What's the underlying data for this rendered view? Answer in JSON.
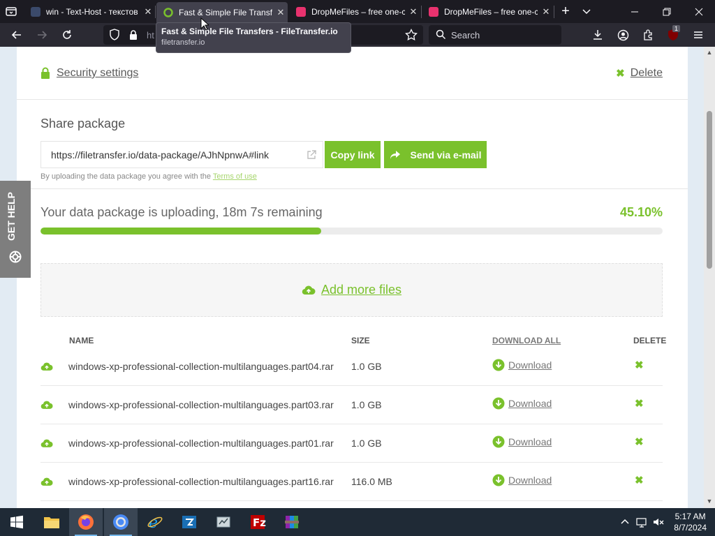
{
  "browser": {
    "tabs": [
      {
        "title": "win - Text-Host - текстов",
        "close": "✕",
        "active": false,
        "favicon_color": "#3b4a6b"
      },
      {
        "title": "Fast & Simple File Transfe",
        "close": "✕",
        "active": true,
        "favicon_color": "#7ac12c"
      },
      {
        "title": "DropMeFiles – free one-cli",
        "close": "✕",
        "active": false,
        "favicon_color": "#e8326e"
      },
      {
        "title": "DropMeFiles – free one-cli",
        "close": "✕",
        "active": false,
        "favicon_color": "#e8326e"
      }
    ],
    "new_tab": "+",
    "url_visible_fragment": "ht                                          wA",
    "search_placeholder": "Search",
    "notification_badge": "1",
    "tooltip": {
      "title": "Fast & Simple File Transfers - FileTransfer.io",
      "host": "filetransfer.io"
    }
  },
  "page": {
    "security_link": "Security settings",
    "delete_link": "Delete",
    "share": {
      "title": "Share package",
      "link_value": "https://filetransfer.io/data-package/AJhNpnwA#link",
      "copy_button": "Copy link",
      "email_button": "Send via e-mail",
      "terms_prefix": "By uploading the data package you agree with the",
      "terms_link": "Terms of use"
    },
    "upload": {
      "status": "Your data package is uploading, 18m 7s remaining",
      "percent_text": "45.10%",
      "progress_fraction": 0.451
    },
    "add_more": "Add more files",
    "table": {
      "headers": {
        "name": "NAME",
        "size": "SIZE",
        "download_all": "DOWNLOAD ALL",
        "delete": "DELETE"
      },
      "rows": [
        {
          "name": "windows-xp-professional-collection-multilanguages.part04.rar",
          "size": "1.0 GB",
          "download": "Download"
        },
        {
          "name": "windows-xp-professional-collection-multilanguages.part03.rar",
          "size": "1.0 GB",
          "download": "Download"
        },
        {
          "name": "windows-xp-professional-collection-multilanguages.part01.rar",
          "size": "1.0 GB",
          "download": "Download"
        },
        {
          "name": "windows-xp-professional-collection-multilanguages.part16.rar",
          "size": "116.0 MB",
          "download": "Download"
        }
      ]
    },
    "get_help": "GET HELP",
    "accent_color": "#7ac12c"
  },
  "taskbar": {
    "time": "5:17 AM",
    "date": "8/7/2024",
    "apps": [
      "start-icon",
      "file-explorer-icon",
      "firefox-icon",
      "chrome-icon",
      "internet-explorer-icon",
      "filezilla-server-icon",
      "network-tool-icon",
      "filezilla-icon",
      "winrar-icon"
    ]
  }
}
